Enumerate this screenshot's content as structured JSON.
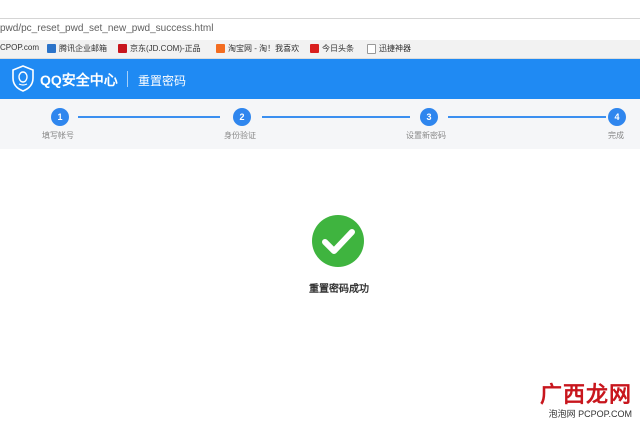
{
  "browser": {
    "url": "pwd/pc_reset_pwd_set_new_pwd_success.html",
    "bookmarks": [
      {
        "label": "CPOP.com",
        "color": ""
      },
      {
        "label": "腾讯企业邮箱",
        "color": "#2c74c9"
      },
      {
        "label": "京东(JD.COM)-正品",
        "color": "#c8161d"
      },
      {
        "label": "淘宝网 - 淘！我喜欢",
        "color": "#f36d21"
      },
      {
        "label": "今日头条",
        "color": "#d9201f"
      },
      {
        "label": "迅捷神器",
        "color": "#aaaaaa"
      }
    ]
  },
  "header": {
    "brand": "QQ安全中心",
    "title": "重置密码"
  },
  "steps": [
    {
      "num": "1",
      "label": "填写帐号"
    },
    {
      "num": "2",
      "label": "身份验证"
    },
    {
      "num": "3",
      "label": "设置新密码"
    },
    {
      "num": "4",
      "label": "完成"
    }
  ],
  "result": {
    "message": "重置密码成功"
  },
  "watermark": {
    "big": "广西龙网",
    "small": "泡泡网 PCPOP.COM"
  },
  "colors": {
    "header_bg": "#1f8af3",
    "step_active": "#2f86ee",
    "success_green": "#3fb43f"
  }
}
